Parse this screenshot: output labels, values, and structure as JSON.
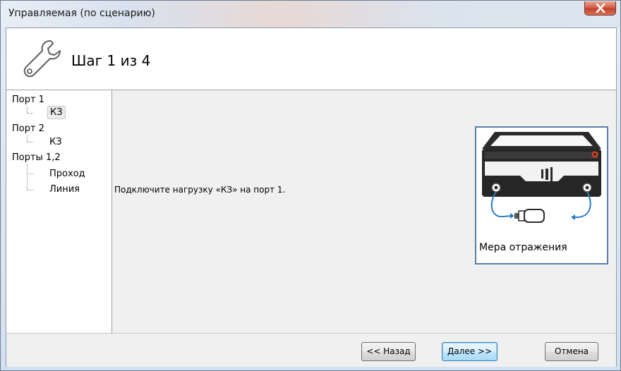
{
  "window": {
    "title": "Управляемая (по сценарию)",
    "close_icon": "close-icon"
  },
  "header": {
    "icon": "wrench-icon",
    "step_title": "Шаг 1 из 4"
  },
  "tree": {
    "groups": [
      {
        "label": "Порт 1",
        "children": [
          "КЗ"
        ]
      },
      {
        "label": "Порт 2",
        "children": [
          "КЗ"
        ]
      },
      {
        "label": "Порты 1,2",
        "children": [
          "Проход",
          "Линия"
        ]
      }
    ],
    "selected": "Порт 1 / КЗ"
  },
  "main": {
    "instruction": "Подключите нагрузку «КЗ» на порт 1.",
    "device": {
      "icon": "reflection-standard-device-icon",
      "caption": "Мера отражения",
      "accent_color": "#2c7bc0",
      "indicator_color": "#e0401f"
    }
  },
  "footer": {
    "back_label": "<< Назад",
    "next_label": "Далее >>",
    "cancel_label": "Отмена"
  }
}
